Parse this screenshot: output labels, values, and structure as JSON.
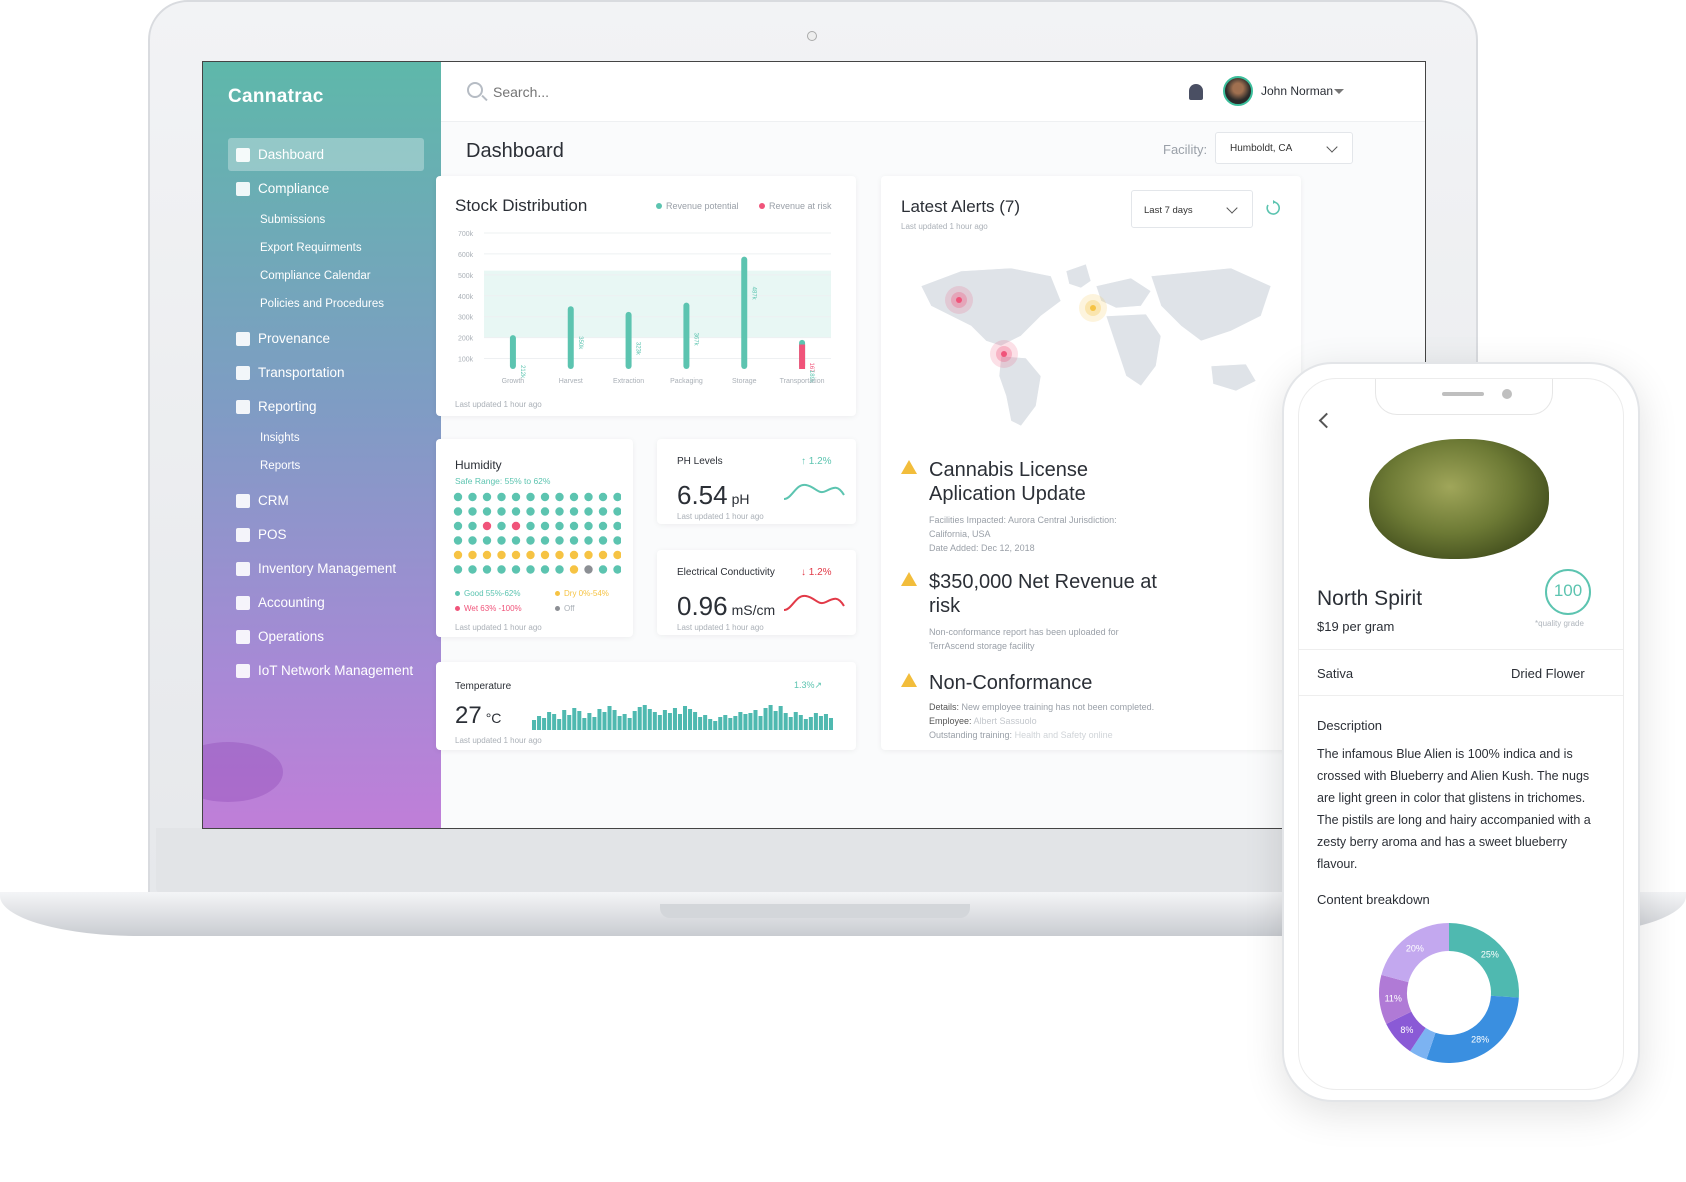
{
  "app": {
    "brand": "Cannatrac"
  },
  "sidebar": {
    "items": [
      {
        "label": "Dashboard",
        "icon": "bar-chart-icon",
        "active": true
      },
      {
        "label": "Compliance",
        "icon": "shield-icon",
        "sub": [
          "Submissions",
          "Export Requirments",
          "Compliance Calendar",
          "Policies and Procedures"
        ]
      },
      {
        "label": "Provenance",
        "icon": "globe-icon"
      },
      {
        "label": "Transportation",
        "icon": "truck-icon"
      },
      {
        "label": "Reporting",
        "icon": "document-icon",
        "sub": [
          "Insights",
          "Reports"
        ]
      },
      {
        "label": "CRM",
        "icon": "contacts-icon"
      },
      {
        "label": "POS",
        "icon": "calculator-icon"
      },
      {
        "label": "Inventory Management",
        "icon": "box-icon"
      },
      {
        "label": "Accounting",
        "icon": "ledger-icon"
      },
      {
        "label": "Operations",
        "icon": "gear-icon"
      },
      {
        "label": "IoT Network Management",
        "icon": "cloud-icon"
      }
    ]
  },
  "topbar": {
    "search_placeholder": "Search...",
    "user_name": "John Norman"
  },
  "page": {
    "title": "Dashboard",
    "facility_label": "Facility:",
    "facility_value": "Humboldt, CA"
  },
  "stock": {
    "title": "Stock Distribution",
    "legend_potential": "Revenue potential",
    "legend_risk": "Revenue at risk",
    "updated": "Last updated 1 hour ago",
    "colors": {
      "potential": "#5cc4b0",
      "risk": "#f0547a",
      "band": "#e8f7f4"
    }
  },
  "chart_data": {
    "type": "bar",
    "categories": [
      "Growth",
      "Harvest",
      "Extraction",
      "Packaging",
      "Storage",
      "Transportation"
    ],
    "series": [
      {
        "name": "Revenue potential",
        "values": [
          212,
          350,
          323,
          367,
          587,
          189
        ],
        "labels": [
          "212k",
          "350k",
          "323k",
          "367k",
          "487k",
          "189k"
        ]
      },
      {
        "name": "Revenue at risk",
        "values": [
          0,
          0,
          0,
          0,
          0,
          167
        ],
        "labels": [
          "",
          "",
          "",
          "",
          "",
          "167"
        ]
      }
    ],
    "yticks": [
      "100k",
      "200k",
      "300k",
      "400k",
      "500k",
      "600k",
      "700k"
    ],
    "ylim": [
      50,
      700
    ]
  },
  "humidity": {
    "title": "Humidity",
    "safe_range": "Safe Range: 55% to 62%",
    "legend": [
      "Good 55%-62%",
      "Dry 0%-54%",
      "Wet 63% -100%",
      "Off"
    ],
    "updated": "Last updated 1 hour ago",
    "grid": [
      "gggggggggggg",
      "gggggggggggg",
      "ggwgwggggggg",
      "gggggggggggg",
      "yyyyyyyyyyyy",
      "ggggggggyogg"
    ],
    "colors": {
      "g": "#5cc4b0",
      "w": "#f0547a",
      "y": "#f6c343",
      "o": "#8c8f94"
    }
  },
  "ph": {
    "title": "PH Levels",
    "value": "6.54",
    "unit": "pH",
    "delta": "1.2%",
    "updated": "Last updated 1 hour ago"
  },
  "ec": {
    "title": "Electrical Conductivity",
    "value": "0.96",
    "unit": "mS/cm",
    "delta": "1.2%",
    "updated": "Last updated 1 hour ago"
  },
  "temperature": {
    "title": "Temperature",
    "value": "27",
    "unit": "°C",
    "delta": "1.3%",
    "updated": "Last updated 1 hour ago"
  },
  "alerts": {
    "title": "Latest Alerts (7)",
    "updated": "Last updated 1 hour ago",
    "range": "Last 7 days",
    "items": [
      {
        "title": "Cannabis License Aplication Update",
        "body": [
          "Facilities Impacted: Aurora Central Jurisdiction:",
          "California, USA",
          "Date Added: Dec 12, 2018"
        ]
      },
      {
        "title": "$350,000 Net Revenue at risk",
        "body": [
          "Non-conformance report has been uploaded for",
          "TerrAscend storage facility"
        ]
      },
      {
        "title": "Non-Conformance",
        "details_label": "Details:",
        "details": "New employee training has not been completed.",
        "employee_label": "Employee:",
        "employee": "Albert Sassuolo",
        "training_label": "Outstanding training:",
        "training": "Health and Safety online"
      }
    ]
  },
  "phone": {
    "product_name": "North Spirit",
    "price": "$19 per gram",
    "grade": "100",
    "grade_note": "*quality grade",
    "strain": "Sativa",
    "form": "Dried Flower",
    "description_title": "Description",
    "description": "The infamous Blue Alien is 100% indica and is crossed with Blueberry and Alien Kush. The nugs are light green in color that glistens in trichomes. The pistils are long and hairy accompanied with a zesty berry aroma and has a sweet blueberry flavour.",
    "breakdown_title": "Content breakdown",
    "breakdown": [
      {
        "label": "25%",
        "value": 25,
        "color": "#4fb9b0"
      },
      {
        "label": "28%",
        "value": 28,
        "color": "#3a8fe0"
      },
      {
        "label": "",
        "value": 4,
        "color": "#7cb3f2"
      },
      {
        "label": "8%",
        "value": 8,
        "color": "#8a5ad6"
      },
      {
        "label": "11%",
        "value": 11,
        "color": "#b07ad6"
      },
      {
        "label": "20%",
        "value": 20,
        "color": "#c3a8ef"
      }
    ]
  }
}
